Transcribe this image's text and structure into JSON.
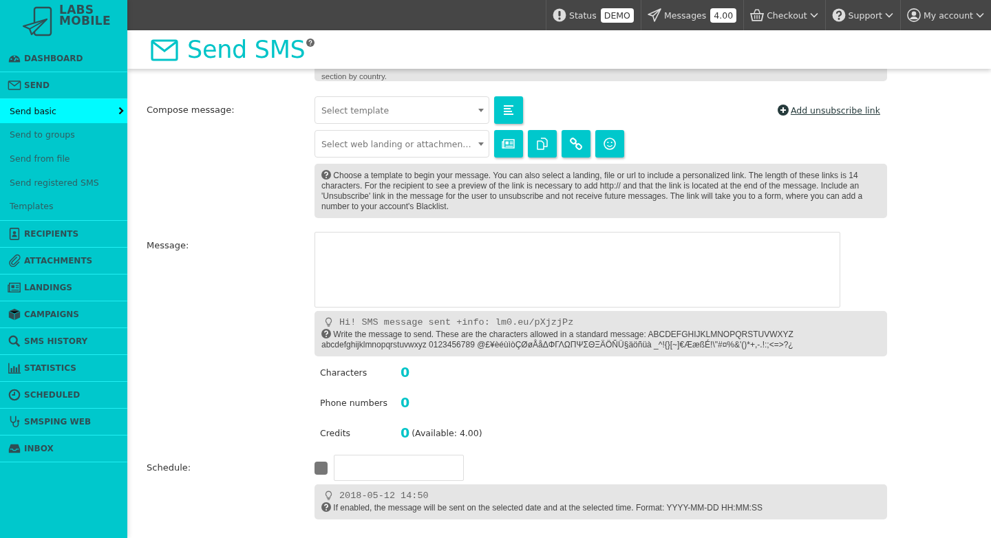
{
  "logo": {
    "line_1": "LABS",
    "line_2": "MOBILE"
  },
  "sidebar": {
    "items": [
      {
        "label": "DASHBOARD"
      },
      {
        "label": "SEND",
        "children": [
          {
            "label": "Send basic",
            "selected": true
          },
          {
            "label": "Send to groups",
            "selected": false
          },
          {
            "label": "Send from file",
            "selected": false
          },
          {
            "label": "Send registered SMS",
            "selected": false
          },
          {
            "label": "Templates",
            "selected": false
          }
        ]
      },
      {
        "label": "RECIPIENTS"
      },
      {
        "label": "ATTACHMENTS"
      },
      {
        "label": "LANDINGS"
      },
      {
        "label": "CAMPAIGNS"
      },
      {
        "label": "SMS HISTORY"
      },
      {
        "label": "STATISTICS"
      },
      {
        "label": "SCHEDULED"
      },
      {
        "label": "SMSPING WEB"
      },
      {
        "label": "INBOX"
      }
    ]
  },
  "top_bar": {
    "items": [
      {
        "label": "Status",
        "badge": "DEMO",
        "dropdown": false
      },
      {
        "label": "Messages",
        "badge": "4.00",
        "dropdown": false
      },
      {
        "label": "Checkout",
        "dropdown": true
      },
      {
        "label": "Support",
        "dropdown": true
      },
      {
        "label": "My account",
        "dropdown": true
      }
    ]
  },
  "page_title": "Send SMS",
  "previous_note": "section by country.",
  "compose": {
    "label": "Compose message:",
    "template_select": {
      "placeholder": "Select template"
    },
    "landing_select": {
      "placeholder": "Select web landing or attachmen…"
    },
    "unsubscribe_link": "Add unsubscribe link",
    "help": "Choose a template to begin your message. You can also select a landing, file or url to include a personalized link. The length of these links is 14 characters. For the recipient to see a preview of the link is necessary to add http:// and that the link is located at the end of the message. Include an 'Unsubscribe' link in the message for the user to unsubscribe and not receive future messages. The link will take you to a form, where you can add a number to your account's Blacklist."
  },
  "message": {
    "label": "Message:",
    "example": "Hi! SMS message sent +info: lm0.eu/pXjzjPz",
    "help": "Write the message to send. These are the characters allowed in a standard message: ABCDEFGHIJKLMNOPQRSTUVWXYZ abcdefghijklmnopqrstuvwxyz 0123456789 @£¥èéùìòÇØøÅåΔΦΓΛΩΠΨΣΘΞÄÖÑÜ§äöñüà _^!{}[~]€ÆæßÉ!\\\"#¤%&'()*+,-.!:;<=>?¿"
  },
  "counters": [
    {
      "label": "Characters",
      "value": "0"
    },
    {
      "label": "Phone numbers",
      "value": "0"
    },
    {
      "label": "Credits",
      "value": "0",
      "note": "(Available: 4.00)"
    }
  ],
  "schedule": {
    "label": "Schedule:",
    "checked": false,
    "example": "2018-05-12 14:50",
    "help": "If enabled, the message will be sent on the selected date and at the selected time. Format: YYYY-MM-DD HH:MM:SS"
  }
}
